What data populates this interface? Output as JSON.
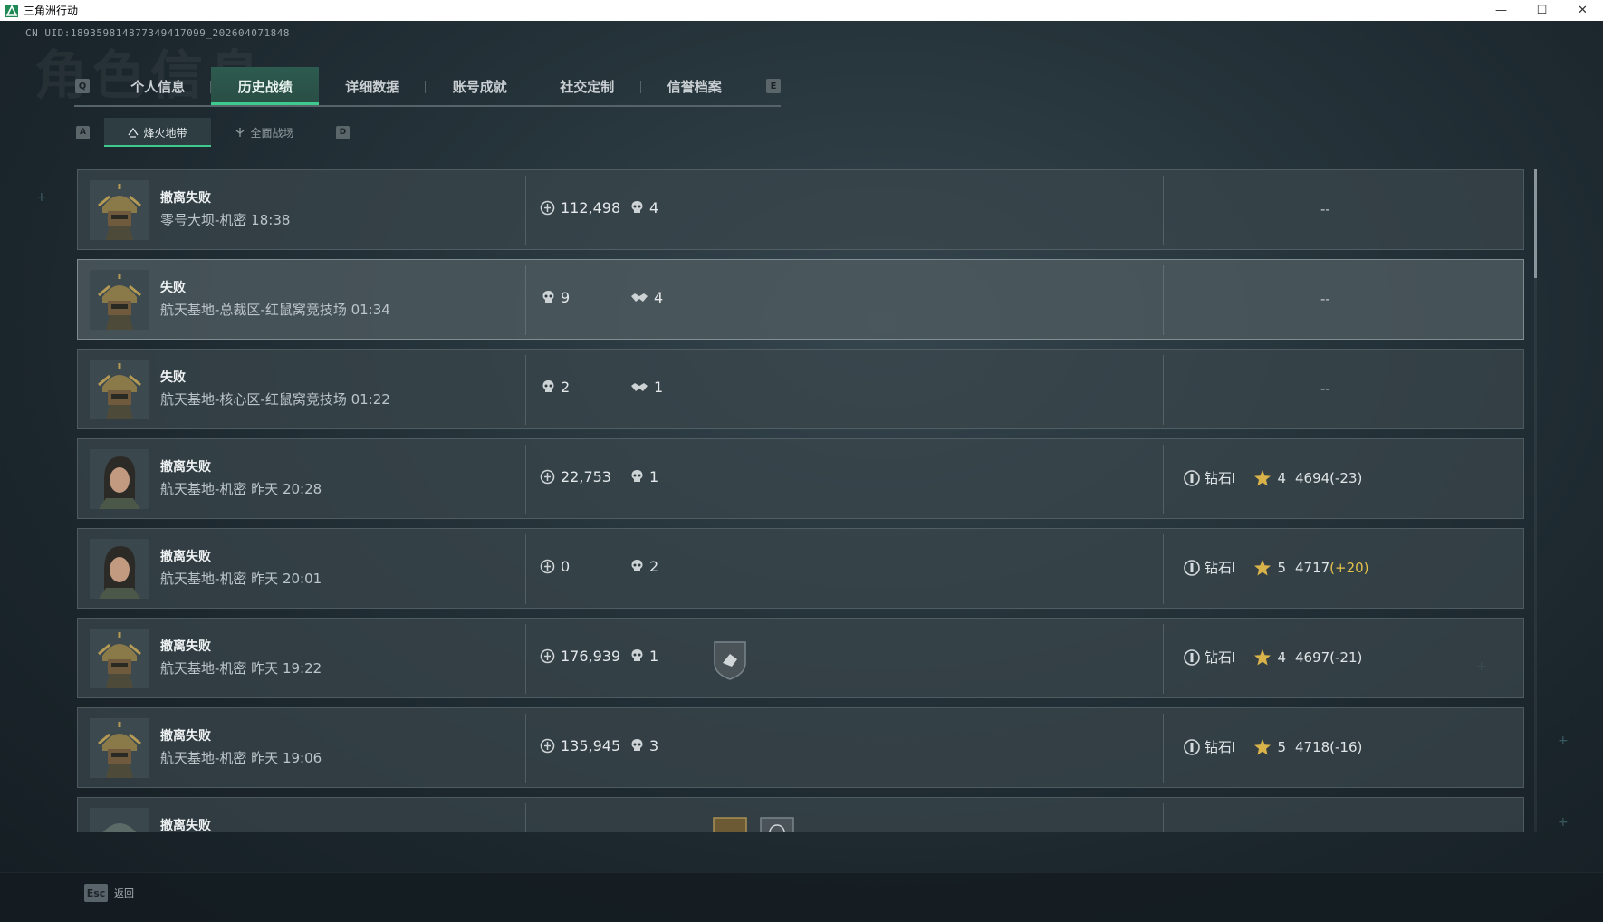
{
  "window": {
    "title": "三角洲行动",
    "minimize": "—",
    "maximize": "☐",
    "close": "✕"
  },
  "header": {
    "uid": "CN UID:1893598148773494170​99_202604071848",
    "bg_heading": "角色信息"
  },
  "tabs": {
    "left_key": "Q",
    "right_key": "E",
    "items": [
      "个人信息",
      "历史战绩",
      "详细数据",
      "账号成就",
      "社交定制",
      "信誉档案"
    ],
    "active": "历史战绩"
  },
  "subtabs": {
    "left_key": "A",
    "right_key": "D",
    "items": [
      "烽火地带",
      "全面战场"
    ],
    "active": "烽火地带"
  },
  "colors": {
    "accent": "#3ec98f",
    "gain": "#e3c04a"
  },
  "records": [
    {
      "avatar": "masked-soldier",
      "result": "撤离失败",
      "map": "零号大坝-机密 18:38",
      "value": "112,498",
      "kills": "4",
      "rank": "--"
    },
    {
      "avatar": "masked-soldier",
      "result": "失败",
      "map": "航天基地-总裁区-红鼠窝竞技场 01:34",
      "kills": "9",
      "assists": "4",
      "rank": "--",
      "highlight": true
    },
    {
      "avatar": "masked-soldier",
      "result": "失败",
      "map": "航天基地-核心区-红鼠窝竞技场 01:22",
      "kills": "2",
      "assists": "1",
      "rank": "--"
    },
    {
      "avatar": "female-operator",
      "result": "撤离失败",
      "map": "航天基地-机密 昨天 20:28",
      "value": "22,753",
      "kills": "1",
      "rank_name": "钻石I",
      "stars": "4",
      "score": "4694",
      "delta": "(-23)"
    },
    {
      "avatar": "female-operator",
      "result": "撤离失败",
      "map": "航天基地-机密 昨天 20:01",
      "value": "0",
      "kills": "2",
      "rank_name": "钻石I",
      "stars": "5",
      "score": "4717",
      "delta": "(+20)",
      "delta_positive": true
    },
    {
      "avatar": "masked-soldier",
      "result": "撤离失败",
      "map": "航天基地-机密 昨天 19:22",
      "value": "176,939",
      "kills": "1",
      "badge": "shield-badge",
      "rank_name": "钻石I",
      "stars": "4",
      "score": "4697",
      "delta": "(-21)"
    },
    {
      "avatar": "masked-soldier",
      "result": "撤离失败",
      "map": "航天基地-机密 昨天 19:06",
      "value": "135,945",
      "kills": "3",
      "rank_name": "钻石I",
      "stars": "5",
      "score": "4718",
      "delta": "(-16)"
    },
    {
      "avatar": "helmet-soldier",
      "result": "撤离失败",
      "map": "",
      "badges_partial": true
    }
  ],
  "footer": {
    "esc_key": "Esc",
    "esc_label": "返回"
  }
}
